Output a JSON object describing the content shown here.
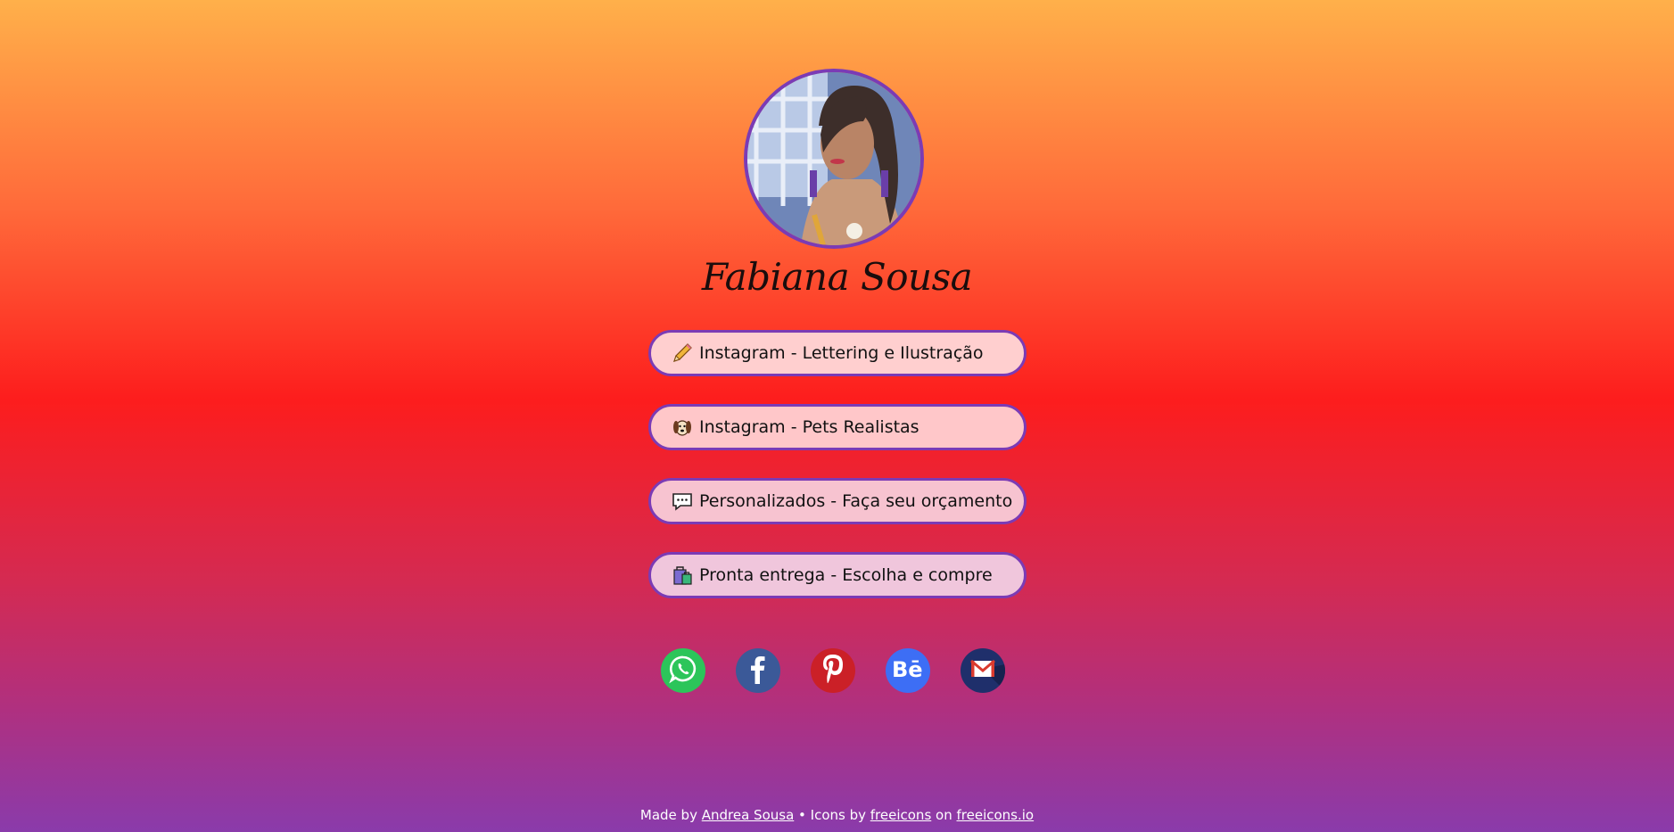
{
  "profile": {
    "name": "Fabiana Sousa",
    "avatar_icon": "profile-photo"
  },
  "links": [
    {
      "label": "Instagram - Lettering e Ilustração",
      "icon": "pencil-icon"
    },
    {
      "label": "Instagram - Pets Realistas",
      "icon": "dog-icon"
    },
    {
      "label": "Personalizados - Faça seu orçamento",
      "icon": "speech-bubble-icon"
    },
    {
      "label": "Pronta entrega - Escolha e compre",
      "icon": "shopping-bags-icon"
    }
  ],
  "social": [
    {
      "name": "whatsapp",
      "icon": "whatsapp-icon",
      "color": "#2cc55a"
    },
    {
      "name": "facebook",
      "icon": "facebook-icon",
      "color": "#3b5998",
      "glyph": "f"
    },
    {
      "name": "pinterest",
      "icon": "pinterest-icon",
      "color": "#cb2027",
      "glyph": "P"
    },
    {
      "name": "behance",
      "icon": "behance-icon",
      "color": "#3d6ef5",
      "glyph": "Bē"
    },
    {
      "name": "gmail",
      "icon": "gmail-icon",
      "color": "#1f2f6b"
    }
  ],
  "footer": {
    "made_by": "Made by",
    "author": "Andrea Sousa",
    "sep": " • Icons by ",
    "icons_author": "freeicons",
    "on": " on ",
    "site": "freeicons.io"
  },
  "colors": {
    "accent_border": "#7b3bb5",
    "gradient_top": "#ffb04a",
    "gradient_mid": "#fd1d1d",
    "gradient_bottom": "#8a3bab"
  }
}
